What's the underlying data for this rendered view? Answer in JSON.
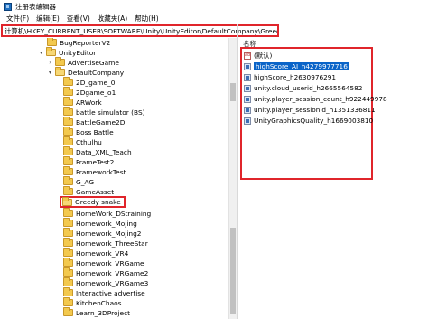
{
  "window": {
    "title": "注册表编辑器"
  },
  "menu": [
    "文件(F)",
    "编辑(E)",
    "查看(V)",
    "收藏夹(A)",
    "帮助(H)"
  ],
  "address": "计算机\\HKEY_CURRENT_USER\\SOFTWARE\\Unity\\UnityEditor\\DefaultCompany\\Greedy snake",
  "tree": {
    "bugreporter": "BugReporterV2",
    "unityeditor": "UnityEditor",
    "advertisegame": "AdvertiseGame",
    "defaultcompany": "DefaultCompany",
    "children": [
      "2D_game_0",
      "2Dgame_o1",
      "ARWork",
      "battle simulator (BS)",
      "BattleGame2D",
      "Boss Battle",
      "Cthulhu",
      "Data_XML_Teach",
      "FrameTest2",
      "FrameworkTest",
      "G_AG",
      "GameAsset",
      "Greedy snake",
      "HomeWork_DStraining",
      "Homework_Mojing",
      "Homework_Mojing2",
      "Homework_ThreeStar",
      "Homework_VR4",
      "Homework_VRGame",
      "Homework_VRGame2",
      "Homework_VRGame3",
      "Interactive advertise",
      "KitchenChaos",
      "Learn_3DProject"
    ]
  },
  "values": {
    "column_name": "名称",
    "rows": [
      {
        "name": "(默认)",
        "type": "ab"
      },
      {
        "name": "highScore_AI_h4279977716",
        "type": "bin"
      },
      {
        "name": "highScore_h2630976291",
        "type": "bin"
      },
      {
        "name": "unity.cloud_userid_h2665564582",
        "type": "bin"
      },
      {
        "name": "unity.player_session_count_h922449978",
        "type": "bin"
      },
      {
        "name": "unity.player_sessionid_h1351336811",
        "type": "bin"
      },
      {
        "name": "UnityGraphicsQuality_h1669003810",
        "type": "bin"
      }
    ]
  }
}
